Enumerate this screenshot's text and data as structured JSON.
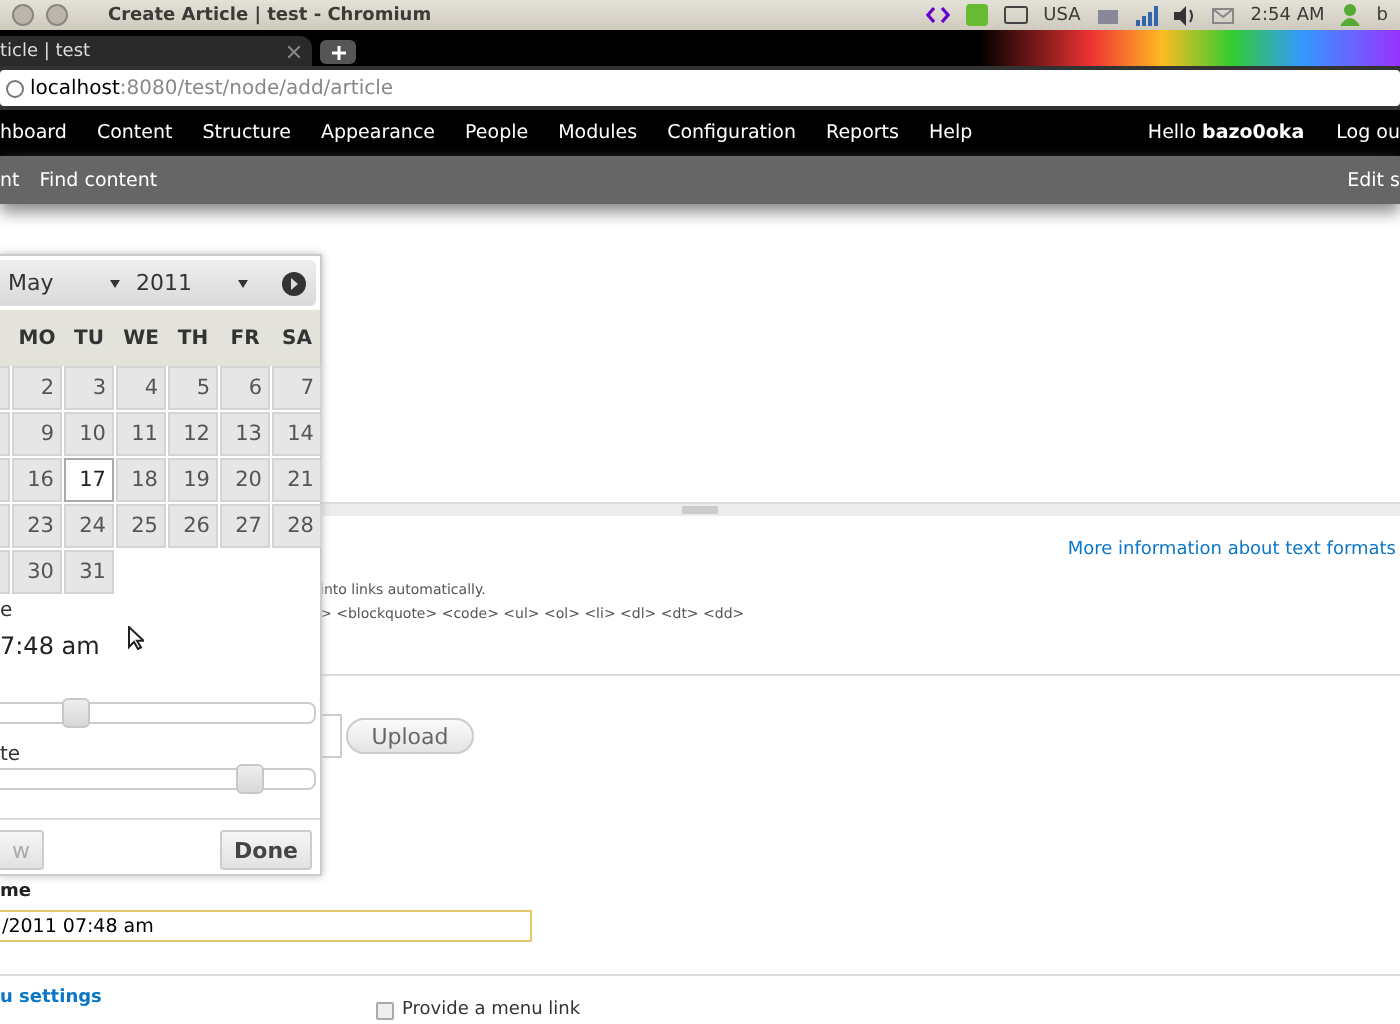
{
  "window": {
    "title": "Create Article | test - Chromium"
  },
  "system_tray": {
    "keyboard_layout": "USA",
    "clock": "2:54 AM",
    "user_initial": "b"
  },
  "browser": {
    "tab": {
      "title": "ticle | test"
    },
    "address": {
      "host": "localhost",
      "rest": ":8080/test/node/add/article"
    }
  },
  "toolbar": {
    "items": [
      "hboard",
      "Content",
      "Structure",
      "Appearance",
      "People",
      "Modules",
      "Configuration",
      "Reports",
      "Help"
    ],
    "greeting": "Hello **bazo0oka**",
    "logout": "Log ou"
  },
  "shortcuts": {
    "items": [
      "nt",
      "Find content"
    ],
    "edit": "Edit s"
  },
  "form": {
    "format_link": "More information about text formats",
    "format_tips": [
      "into links automatically.",
      "> <blockquote> <code> <ul> <ol> <li> <dl> <dt> <dd>"
    ],
    "upload_button": "Upload",
    "date_label": "me",
    "date_value": "/2011 07:48 am",
    "menu_settings": "u settings",
    "menu_checkbox": {
      "label": "Provide a menu link",
      "checked": false
    }
  },
  "datepicker": {
    "month": "May",
    "year": "2011",
    "weekdays": [
      "MO",
      "TU",
      "WE",
      "TH",
      "FR",
      "SA"
    ],
    "weeks": [
      [
        {
          "day": "2",
          "selected": false
        },
        {
          "day": "3",
          "selected": false
        },
        {
          "day": "4",
          "selected": false
        },
        {
          "day": "5",
          "selected": false
        },
        {
          "day": "6",
          "selected": false
        },
        {
          "day": "7",
          "selected": false
        }
      ],
      [
        {
          "day": "9",
          "selected": false
        },
        {
          "day": "10",
          "selected": false
        },
        {
          "day": "11",
          "selected": false
        },
        {
          "day": "12",
          "selected": false
        },
        {
          "day": "13",
          "selected": false
        },
        {
          "day": "14",
          "selected": false
        }
      ],
      [
        {
          "day": "16",
          "selected": false
        },
        {
          "day": "17",
          "selected": true
        },
        {
          "day": "18",
          "selected": false
        },
        {
          "day": "19",
          "selected": false
        },
        {
          "day": "20",
          "selected": false
        },
        {
          "day": "21",
          "selected": false
        }
      ],
      [
        {
          "day": "23",
          "selected": false
        },
        {
          "day": "24",
          "selected": false
        },
        {
          "day": "25",
          "selected": false
        },
        {
          "day": "26",
          "selected": false
        },
        {
          "day": "27",
          "selected": false
        },
        {
          "day": "28",
          "selected": false
        }
      ],
      [
        {
          "day": "30",
          "selected": false
        },
        {
          "day": "31",
          "selected": false
        }
      ]
    ],
    "time_label": "e",
    "time_value": "7:48 am",
    "hour": {
      "level": 0.3
    },
    "minute": {
      "label": "te",
      "level": 0.81
    },
    "now_button": "w",
    "done_button": "Done"
  }
}
